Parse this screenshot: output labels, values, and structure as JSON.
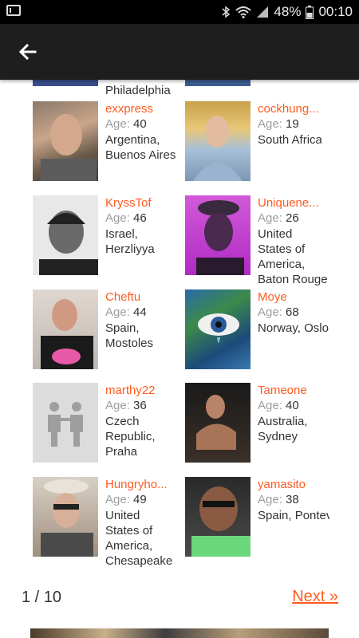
{
  "status_bar": {
    "battery": "48%",
    "time": "00:10",
    "icons": [
      "gmail-icon",
      "bluetooth-icon",
      "wifi-icon",
      "signal-icon",
      "battery-icon"
    ]
  },
  "app_bar": {
    "back_icon": "arrow-left-icon"
  },
  "partial_top": {
    "location_text": "Philadelphia"
  },
  "age_label": "Age:",
  "users": [
    {
      "username": "exxpress",
      "age": "40",
      "location": "Argentina, Buenos Aires"
    },
    {
      "username": "cockhung...",
      "age": "19",
      "location": "South Africa, Johannesbu"
    },
    {
      "username": "KryssTof",
      "age": "46",
      "location": "Israel, Herzliyya"
    },
    {
      "username": "Uniquene...",
      "age": "26",
      "location": "United States of America, Baton Rouge"
    },
    {
      "username": "Cheftu",
      "age": "44",
      "location": "Spain, Mostoles"
    },
    {
      "username": "Moye",
      "age": "68",
      "location": "Norway, Oslo"
    },
    {
      "username": "marthy22",
      "age": "36",
      "location": "Czech Republic, Praha"
    },
    {
      "username": "Tameone",
      "age": "40",
      "location": "Australia, Sydney"
    },
    {
      "username": "Hungryho...",
      "age": "49",
      "location": "United States of America, Chesapeake"
    },
    {
      "username": "yamasito",
      "age": "38",
      "location": "Spain, Pontevedra"
    }
  ],
  "pagination": {
    "page_indicator": "1 / 10",
    "next_label": "Next »"
  },
  "colors": {
    "accent": "#ff5a1f",
    "appbar": "#1e1e1e"
  }
}
